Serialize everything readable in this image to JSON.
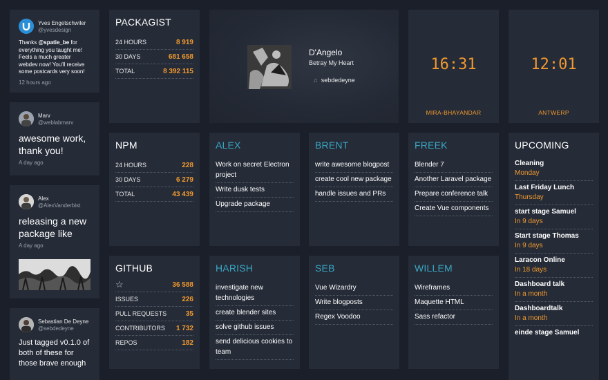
{
  "tweets": [
    {
      "name": "Yves Engetschwiler",
      "handle": "@yvesdesign",
      "body_pre": "Thanks ",
      "body_mention": "@spatie_be",
      "body_post": " for everything you taught me! Feels a much greater webdev now! You'll receive some postcards very soon!",
      "time": "12 hours ago"
    },
    {
      "name": "Marv",
      "handle": "@weblabmarv",
      "body": "awesome work, thank you!",
      "time": "A day ago"
    },
    {
      "name": "Alex",
      "handle": "@AlexVanderbist",
      "body": "releasing a new package like",
      "time": "A day ago"
    },
    {
      "name": "Sebastian De Deyne",
      "handle": "@sebdedeyne",
      "body": "Just tagged v0.1.0 of both of these for those brave enough"
    }
  ],
  "packagist": {
    "title": "PACKAGIST",
    "rows": [
      {
        "label": "24 HOURS",
        "value": "8 919"
      },
      {
        "label": "30 DAYS",
        "value": "681 658"
      },
      {
        "label": "TOTAL",
        "value": "8 392 115"
      }
    ]
  },
  "npm": {
    "title": "NPM",
    "rows": [
      {
        "label": "24 HOURS",
        "value": "228"
      },
      {
        "label": "30 DAYS",
        "value": "6 279"
      },
      {
        "label": "TOTAL",
        "value": "43 439"
      }
    ]
  },
  "github": {
    "title": "GITHUB",
    "star_glyph": "☆",
    "star_value": "36 588",
    "rows": [
      {
        "label": "ISSUES",
        "value": "226"
      },
      {
        "label": "PULL REQUESTS",
        "value": "35"
      },
      {
        "label": "CONTRIBUTORS",
        "value": "1 732"
      },
      {
        "label": "REPOS",
        "value": "182"
      }
    ]
  },
  "music": {
    "artist": "D'Angelo",
    "track": "Betray My Heart",
    "user": "sebdedeyne",
    "note_icon": "♫"
  },
  "clocks": [
    {
      "time": "16:31",
      "city": "MIRA-BHAYANDAR"
    },
    {
      "time": "12:01",
      "city": "ANTWERP"
    }
  ],
  "tasks": {
    "alex": {
      "title": "ALEX",
      "items": [
        "Work on secret Electron project",
        "Write dusk tests",
        "Upgrade package"
      ]
    },
    "brent": {
      "title": "BRENT",
      "items": [
        "write awesome blogpost",
        "create cool new package",
        "handle issues and PRs"
      ]
    },
    "freek": {
      "title": "FREEK",
      "items": [
        "Blender 7",
        "Another Laravel package",
        "Prepare conference talk",
        "Create Vue components"
      ]
    },
    "harish": {
      "title": "HARISH",
      "items": [
        "investigate new technologies",
        "create blender sites",
        "solve github issues",
        "send delicious cookies to team"
      ]
    },
    "seb": {
      "title": "SEB",
      "items": [
        "Vue Wizardry",
        "Write blogposts",
        "Regex Voodoo"
      ]
    },
    "willem": {
      "title": "WILLEM",
      "items": [
        "Wireframes",
        "Maquette HTML",
        "Sass refactor"
      ]
    }
  },
  "upcoming": {
    "title": "UPCOMING",
    "items": [
      {
        "name": "Cleaning",
        "when": "Monday"
      },
      {
        "name": "Last Friday Lunch",
        "when": "Thursday"
      },
      {
        "name": "start stage Samuel",
        "when": "In 9 days"
      },
      {
        "name": "Start stage Thomas",
        "when": "In 9 days"
      },
      {
        "name": "Laracon Online",
        "when": "In 18 days"
      },
      {
        "name": "Dashboard talk",
        "when": "In a month"
      },
      {
        "name": "Dashboardtalk",
        "when": "In a month"
      },
      {
        "name": "einde stage Samuel",
        "when": ""
      }
    ]
  },
  "colors": {
    "accent_orange": "#f19a2f",
    "accent_blue": "#3aa7c4",
    "tile_bg": "#252b37",
    "page_bg": "#1a1f29"
  }
}
